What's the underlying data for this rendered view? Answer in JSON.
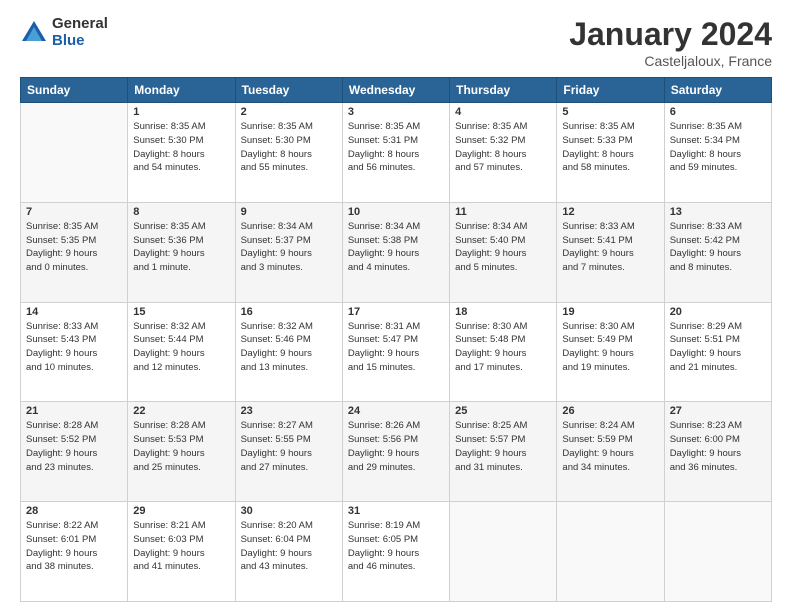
{
  "logo": {
    "general": "General",
    "blue": "Blue"
  },
  "header": {
    "month": "January 2024",
    "location": "Casteljaloux, France"
  },
  "weekdays": [
    "Sunday",
    "Monday",
    "Tuesday",
    "Wednesday",
    "Thursday",
    "Friday",
    "Saturday"
  ],
  "weeks": [
    [
      {
        "day": "",
        "info": ""
      },
      {
        "day": "1",
        "info": "Sunrise: 8:35 AM\nSunset: 5:30 PM\nDaylight: 8 hours\nand 54 minutes."
      },
      {
        "day": "2",
        "info": "Sunrise: 8:35 AM\nSunset: 5:30 PM\nDaylight: 8 hours\nand 55 minutes."
      },
      {
        "day": "3",
        "info": "Sunrise: 8:35 AM\nSunset: 5:31 PM\nDaylight: 8 hours\nand 56 minutes."
      },
      {
        "day": "4",
        "info": "Sunrise: 8:35 AM\nSunset: 5:32 PM\nDaylight: 8 hours\nand 57 minutes."
      },
      {
        "day": "5",
        "info": "Sunrise: 8:35 AM\nSunset: 5:33 PM\nDaylight: 8 hours\nand 58 minutes."
      },
      {
        "day": "6",
        "info": "Sunrise: 8:35 AM\nSunset: 5:34 PM\nDaylight: 8 hours\nand 59 minutes."
      }
    ],
    [
      {
        "day": "7",
        "info": "Sunrise: 8:35 AM\nSunset: 5:35 PM\nDaylight: 9 hours\nand 0 minutes."
      },
      {
        "day": "8",
        "info": "Sunrise: 8:35 AM\nSunset: 5:36 PM\nDaylight: 9 hours\nand 1 minute."
      },
      {
        "day": "9",
        "info": "Sunrise: 8:34 AM\nSunset: 5:37 PM\nDaylight: 9 hours\nand 3 minutes."
      },
      {
        "day": "10",
        "info": "Sunrise: 8:34 AM\nSunset: 5:38 PM\nDaylight: 9 hours\nand 4 minutes."
      },
      {
        "day": "11",
        "info": "Sunrise: 8:34 AM\nSunset: 5:40 PM\nDaylight: 9 hours\nand 5 minutes."
      },
      {
        "day": "12",
        "info": "Sunrise: 8:33 AM\nSunset: 5:41 PM\nDaylight: 9 hours\nand 7 minutes."
      },
      {
        "day": "13",
        "info": "Sunrise: 8:33 AM\nSunset: 5:42 PM\nDaylight: 9 hours\nand 8 minutes."
      }
    ],
    [
      {
        "day": "14",
        "info": "Sunrise: 8:33 AM\nSunset: 5:43 PM\nDaylight: 9 hours\nand 10 minutes."
      },
      {
        "day": "15",
        "info": "Sunrise: 8:32 AM\nSunset: 5:44 PM\nDaylight: 9 hours\nand 12 minutes."
      },
      {
        "day": "16",
        "info": "Sunrise: 8:32 AM\nSunset: 5:46 PM\nDaylight: 9 hours\nand 13 minutes."
      },
      {
        "day": "17",
        "info": "Sunrise: 8:31 AM\nSunset: 5:47 PM\nDaylight: 9 hours\nand 15 minutes."
      },
      {
        "day": "18",
        "info": "Sunrise: 8:30 AM\nSunset: 5:48 PM\nDaylight: 9 hours\nand 17 minutes."
      },
      {
        "day": "19",
        "info": "Sunrise: 8:30 AM\nSunset: 5:49 PM\nDaylight: 9 hours\nand 19 minutes."
      },
      {
        "day": "20",
        "info": "Sunrise: 8:29 AM\nSunset: 5:51 PM\nDaylight: 9 hours\nand 21 minutes."
      }
    ],
    [
      {
        "day": "21",
        "info": "Sunrise: 8:28 AM\nSunset: 5:52 PM\nDaylight: 9 hours\nand 23 minutes."
      },
      {
        "day": "22",
        "info": "Sunrise: 8:28 AM\nSunset: 5:53 PM\nDaylight: 9 hours\nand 25 minutes."
      },
      {
        "day": "23",
        "info": "Sunrise: 8:27 AM\nSunset: 5:55 PM\nDaylight: 9 hours\nand 27 minutes."
      },
      {
        "day": "24",
        "info": "Sunrise: 8:26 AM\nSunset: 5:56 PM\nDaylight: 9 hours\nand 29 minutes."
      },
      {
        "day": "25",
        "info": "Sunrise: 8:25 AM\nSunset: 5:57 PM\nDaylight: 9 hours\nand 31 minutes."
      },
      {
        "day": "26",
        "info": "Sunrise: 8:24 AM\nSunset: 5:59 PM\nDaylight: 9 hours\nand 34 minutes."
      },
      {
        "day": "27",
        "info": "Sunrise: 8:23 AM\nSunset: 6:00 PM\nDaylight: 9 hours\nand 36 minutes."
      }
    ],
    [
      {
        "day": "28",
        "info": "Sunrise: 8:22 AM\nSunset: 6:01 PM\nDaylight: 9 hours\nand 38 minutes."
      },
      {
        "day": "29",
        "info": "Sunrise: 8:21 AM\nSunset: 6:03 PM\nDaylight: 9 hours\nand 41 minutes."
      },
      {
        "day": "30",
        "info": "Sunrise: 8:20 AM\nSunset: 6:04 PM\nDaylight: 9 hours\nand 43 minutes."
      },
      {
        "day": "31",
        "info": "Sunrise: 8:19 AM\nSunset: 6:05 PM\nDaylight: 9 hours\nand 46 minutes."
      },
      {
        "day": "",
        "info": ""
      },
      {
        "day": "",
        "info": ""
      },
      {
        "day": "",
        "info": ""
      }
    ]
  ]
}
